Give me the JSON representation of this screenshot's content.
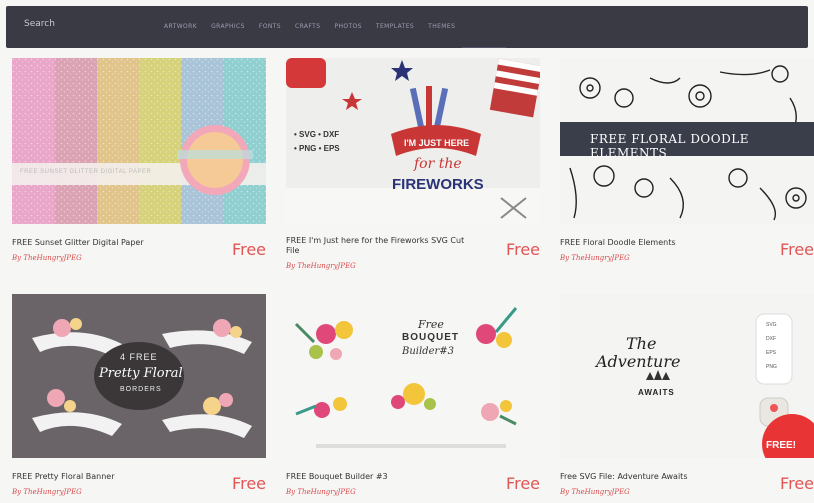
{
  "header": {
    "search_placeholder": "Search",
    "nav": [
      "ARTWORK",
      "GRAPHICS",
      "FONTS",
      "CRAFTS",
      "PHOTOS",
      "TEMPLATES",
      "THEMES"
    ]
  },
  "products": [
    {
      "title": "FREE Sunset Glitter Digital Paper",
      "author": "By TheHungryJPEG",
      "price": "Free",
      "thumb_text": [
        "FREE SUNSET GLITTER DIGITAL PAPER"
      ]
    },
    {
      "title": "FREE I'm Just here for the Fireworks SVG Cut File",
      "author": "By TheHungryJPEG",
      "price": "Free",
      "thumb_text": [
        "• SVG  • DXF",
        "• PNG  • EPS",
        "I'M JUST HERE",
        "for the",
        "FIREWORKS"
      ]
    },
    {
      "title": "FREE Floral Doodle Elements",
      "author": "By TheHungryJPEG",
      "price": "Free",
      "thumb_text": [
        "FREE FLORAL DOODLE ELEMENTS"
      ]
    },
    {
      "title": "FREE Pretty Floral Banner",
      "author": "By TheHungryJPEG",
      "price": "Free",
      "thumb_text": [
        "4 FREE",
        "Pretty Floral",
        "BORDERS"
      ]
    },
    {
      "title": "FREE Bouquet Builder #3",
      "author": "By TheHungryJPEG",
      "price": "Free",
      "thumb_text": [
        "Free",
        "BOUQUET",
        "Builder#3"
      ]
    },
    {
      "title": "Free SVG File: Adventure Awaits",
      "author": "By TheHungryJPEG",
      "price": "Free",
      "thumb_text": [
        "The",
        "Adventure",
        "AWAITS",
        "SVG",
        "DXF",
        "EPS",
        "PNG",
        "FREE!"
      ]
    }
  ],
  "colors": {
    "topbar": "#3a3a45",
    "price": "#e25555",
    "author": "#d94a4a"
  }
}
